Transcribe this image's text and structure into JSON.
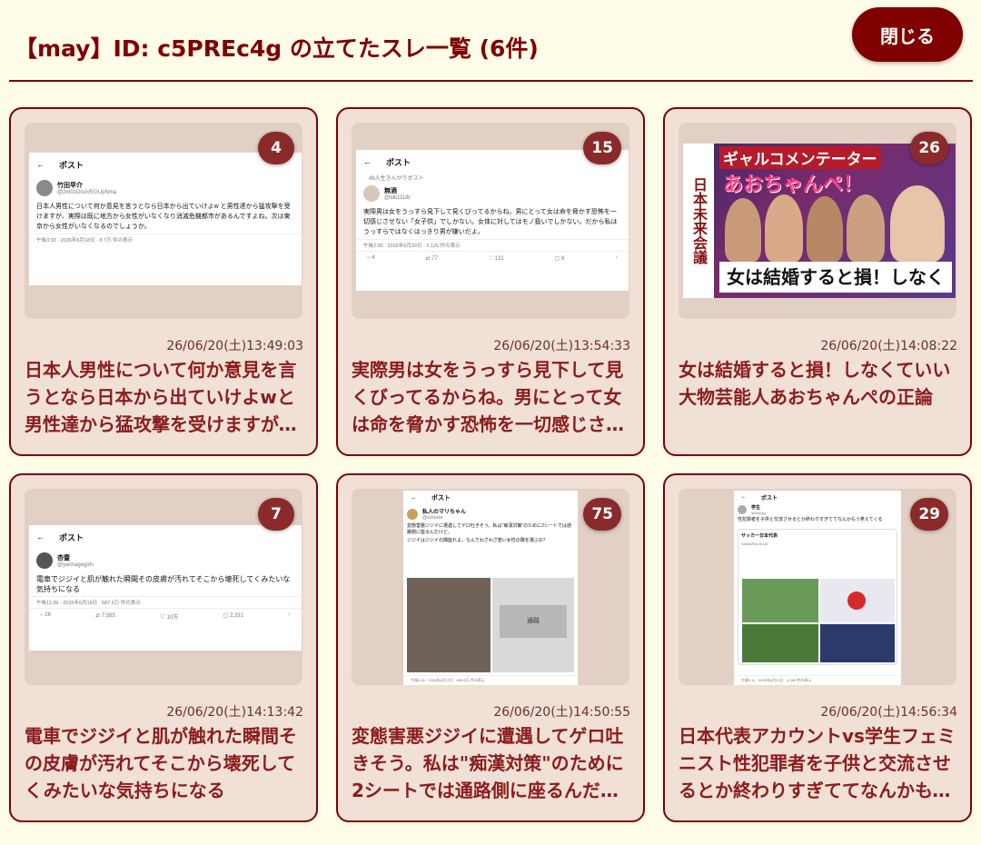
{
  "header": {
    "title": "【may】ID: c5PREc4g の立てたスレ一覧 (6件)",
    "close_label": "閉じる"
  },
  "colors": {
    "accent": "#800000",
    "background": "#fffde8",
    "card": "#f0e0d6",
    "badge": "#8b2a2a"
  },
  "threads": [
    {
      "count": "4",
      "date": "26/06/20(土)13:49:03",
      "title": "日本人男性について何か意見を言うとなら日本から出ていけよwと男性達から猛攻撃を受けますが、実際は既に地方から女性がいなくなり消滅危機都市があるんですよね。",
      "thumb": {
        "kind": "tweet",
        "header": "ポスト",
        "name": "竹田早介",
        "handle": "@2m0zOnuVEGUpNma",
        "text": "日本人男性について何か意見を言うとなら日本から出ていけよw と男性達から猛攻撃を受けますが、実際は既に地方から女性がいなくなり消滅危機都市があるんですよね。次は東京から女性がいなくなるのでしょうか。",
        "meta": "午後3:33 · 2026年6月18日 · 8.7万 件の表示"
      }
    },
    {
      "count": "15",
      "date": "26/06/20(土)13:54:33",
      "title": "実際男は女をうっすら見下して見くびってるからね。男にとって女は命を脅かす恐怖を一切感じさせない「女子供」でしかない。",
      "thumb": {
        "kind": "tweet",
        "header": "ポスト",
        "repost": "48人生きんがりポスト",
        "name": "無酒",
        "handle": "@tdk1118t",
        "text": "実際男は女をうっすら見下して見くびってるからね。男にとって女は命を脅かす恐怖を一切感じさせない「女子供」でしかない。女体に対してはモノ扱いでしかない。だから私はうっすらではなくはっきり男が嫌いだよ。",
        "meta": "午後2:00 · 2026年6月20日 · 2,125 件の表示",
        "actions": [
          "4",
          "77",
          "131",
          "8",
          ""
        ]
      }
    },
    {
      "count": "26",
      "date": "26/06/20(土)14:08:22",
      "title": "女は結婚すると損！しなくていい大物芸能人あおちゃんぺの正論",
      "thumb": {
        "kind": "tv",
        "side": "日本未来会議",
        "head1": "ギャルコメンテーター",
        "head2": "あおちゃんぺ！",
        "sub": "女は結婚すると損！しなくていい！"
      }
    },
    {
      "count": "7",
      "date": "26/06/20(土)14:13:42",
      "title": "電車でジジイと肌が触れた瞬間その皮膚が汚れてそこから壊死してくみたいな気持ちになる",
      "thumb": {
        "kind": "tweet",
        "header": "ポスト",
        "name": "杏壷",
        "handle": "@yarinagegirls",
        "text": "電車でジジイと肌が触れた瞬間その皮膚が汚れてそこから壊死してくみたいな気持ちになる",
        "meta": "午後11:39 · 2026年6月16日 · 587.6万 件の表示",
        "actions": [
          "26",
          "7,585",
          "10万",
          "2,231",
          ""
        ]
      }
    },
    {
      "count": "75",
      "date": "26/06/20(土)14:50:55",
      "title": "変態害悪ジジイに遭遇してゲロ吐きそう。私は\"痴漢対策\"のために2シートでは通路側に座るんだけど、",
      "thumb": {
        "kind": "tweet-tall",
        "header": "ポスト",
        "name": "私人のマリちゃん",
        "handle": "@xxxxxxx",
        "text": "変態害悪ジジイに遭遇してゲロ吐きそう。私は\"痴漢対策\"のために2シートでは通路側に座るんだけど、",
        "text2": "ジジイはジジイの隣座れよ。なんでわざわざ若い女性の隣を選ぶの？",
        "aisle": "通路",
        "meta": "午後4:16 · 2026年6月17日 · 889.8万 件の表示"
      }
    },
    {
      "count": "29",
      "date": "26/06/20(土)14:56:34",
      "title": "日本代表アカウントvs学生フェミニスト性犯罪者を子供と交流させるとか終わりすぎててなんかもう笑えてくる",
      "thumb": {
        "kind": "tweet-tall",
        "header": "ポスト",
        "name": "学生",
        "handle": "@msbjqj",
        "text": "性犯罪者を子供と交流させるとか終わりすぎててなんかもう笑えてくる",
        "quote_name": "サッカー日本代表",
        "quote_tag": "SAMURAI BLUE",
        "meta": "午後3:11 · 2026年6月20日 · 4,360 件の表示"
      }
    }
  ]
}
